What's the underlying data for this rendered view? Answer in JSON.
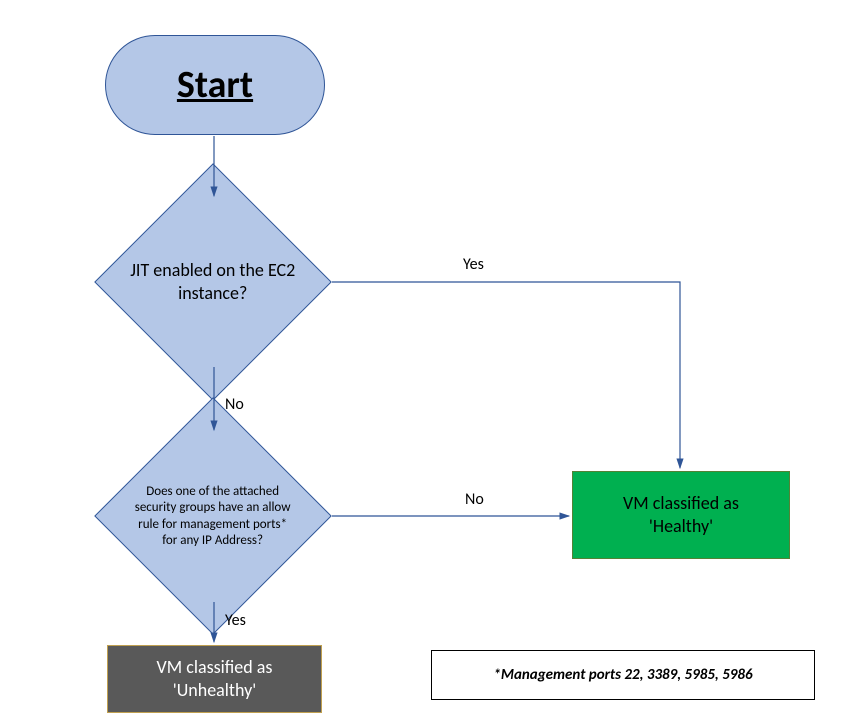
{
  "chart_data": {
    "type": "flowchart",
    "nodes": [
      {
        "id": "start",
        "shape": "terminator",
        "label": "Start"
      },
      {
        "id": "d1",
        "shape": "decision",
        "label": "JIT enabled on the EC2 instance?"
      },
      {
        "id": "d2",
        "shape": "decision",
        "label": "Does one of the attached security groups have an allow rule for management ports* for any IP Address?"
      },
      {
        "id": "unhealthy",
        "shape": "process",
        "label": "VM classified as 'Unhealthy'",
        "fill": "#595959",
        "text_color": "white"
      },
      {
        "id": "healthy",
        "shape": "process",
        "label": "VM classified as 'Healthy'",
        "fill": "#00b050",
        "text_color": "black"
      },
      {
        "id": "note",
        "shape": "note",
        "label": "*Management ports 22, 3389, 5985, 5986"
      }
    ],
    "edges": [
      {
        "from": "start",
        "to": "d1",
        "label": ""
      },
      {
        "from": "d1",
        "to": "healthy",
        "label": "Yes"
      },
      {
        "from": "d1",
        "to": "d2",
        "label": "No"
      },
      {
        "from": "d2",
        "to": "healthy",
        "label": "No"
      },
      {
        "from": "d2",
        "to": "unhealthy",
        "label": "Yes"
      }
    ]
  },
  "start": {
    "label": "Start"
  },
  "d1": {
    "label": "JIT enabled on the EC2 instance?"
  },
  "d2": {
    "label": "Does one of the attached security groups have an allow rule for management ports* for any IP Address?"
  },
  "unhealthy": {
    "line1": "VM classified as",
    "line2": "'Unhealthy'"
  },
  "healthy": {
    "line1": "VM classified as",
    "line2": "'Healthy'"
  },
  "note": {
    "label": "*Management ports 22, 3389, 5985, 5986"
  },
  "labels": {
    "d1_yes": "Yes",
    "d1_no": "No",
    "d2_no": "No",
    "d2_yes": "Yes"
  }
}
